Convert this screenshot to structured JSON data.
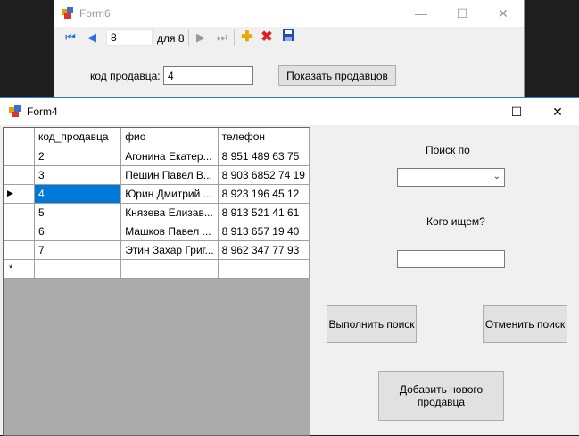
{
  "form6": {
    "title": "Form6",
    "navigator": {
      "position": "8",
      "count_label": "для 8"
    },
    "seller_code_label": "код продавца:",
    "seller_code_value": "4",
    "show_button": "Показать продавцов"
  },
  "form4": {
    "title": "Form4",
    "grid": {
      "columns": [
        "код_продавца",
        "фио",
        "телефон"
      ],
      "rows": [
        {
          "code": "2",
          "name": "Агонина Екатер...",
          "phone": "8 951 489 63 75"
        },
        {
          "code": "3",
          "name": "Пешин Павел В...",
          "phone": "8 903 6852 74 19"
        },
        {
          "code": "4",
          "name": "Юрин Дмитрий ...",
          "phone": "8 923 196 45 12"
        },
        {
          "code": "5",
          "name": "Князева Елизав...",
          "phone": "8 913 521 41 61"
        },
        {
          "code": "6",
          "name": "Машков Павел ...",
          "phone": "8 913 657 19 40"
        },
        {
          "code": "7",
          "name": "Этин Захар Григ...",
          "phone": "8 962 347 77 93"
        }
      ],
      "current_row_marker": "▶",
      "new_row_marker": "*"
    },
    "search_by_label": "Поиск по",
    "search_by_value": "",
    "who_label": "Кого ищем?",
    "who_value": "",
    "execute_button": "Выполнить поиск",
    "cancel_button": "Отменить поиск",
    "add_button": "Добавить нового продавца"
  },
  "colors": {
    "selection": "#0078d7",
    "window_bg": "#f0f0f0",
    "desktop": "#1e1e1e"
  }
}
